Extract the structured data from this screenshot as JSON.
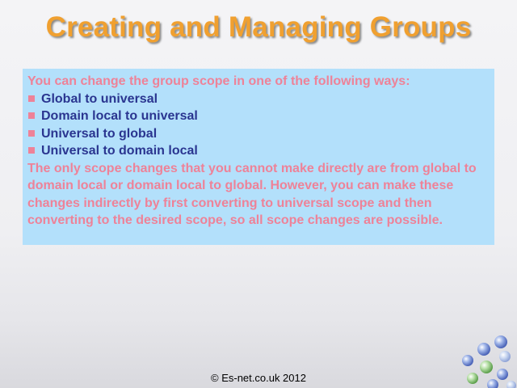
{
  "slide": {
    "title": "Creating and Managing Groups",
    "intro": "You can change the group scope in one of the following ways:",
    "bullets": [
      "Global to universal",
      "Domain local to universal",
      "Universal to global",
      "Universal to domain local"
    ],
    "body": "The only scope changes that you cannot make directly are from global to domain local or domain local to global. However, you can make these changes indirectly by first converting to universal scope and then converting to the desired scope, so all scope changes are possible.",
    "footer": "© Es-net.co.uk 2012"
  },
  "colors": {
    "title": "#f0a030",
    "box_background": "#b3e0fb",
    "pink_text": "#ee8298",
    "bullet_text": "#2a3590"
  },
  "decoration": "blue-green-bubbles"
}
